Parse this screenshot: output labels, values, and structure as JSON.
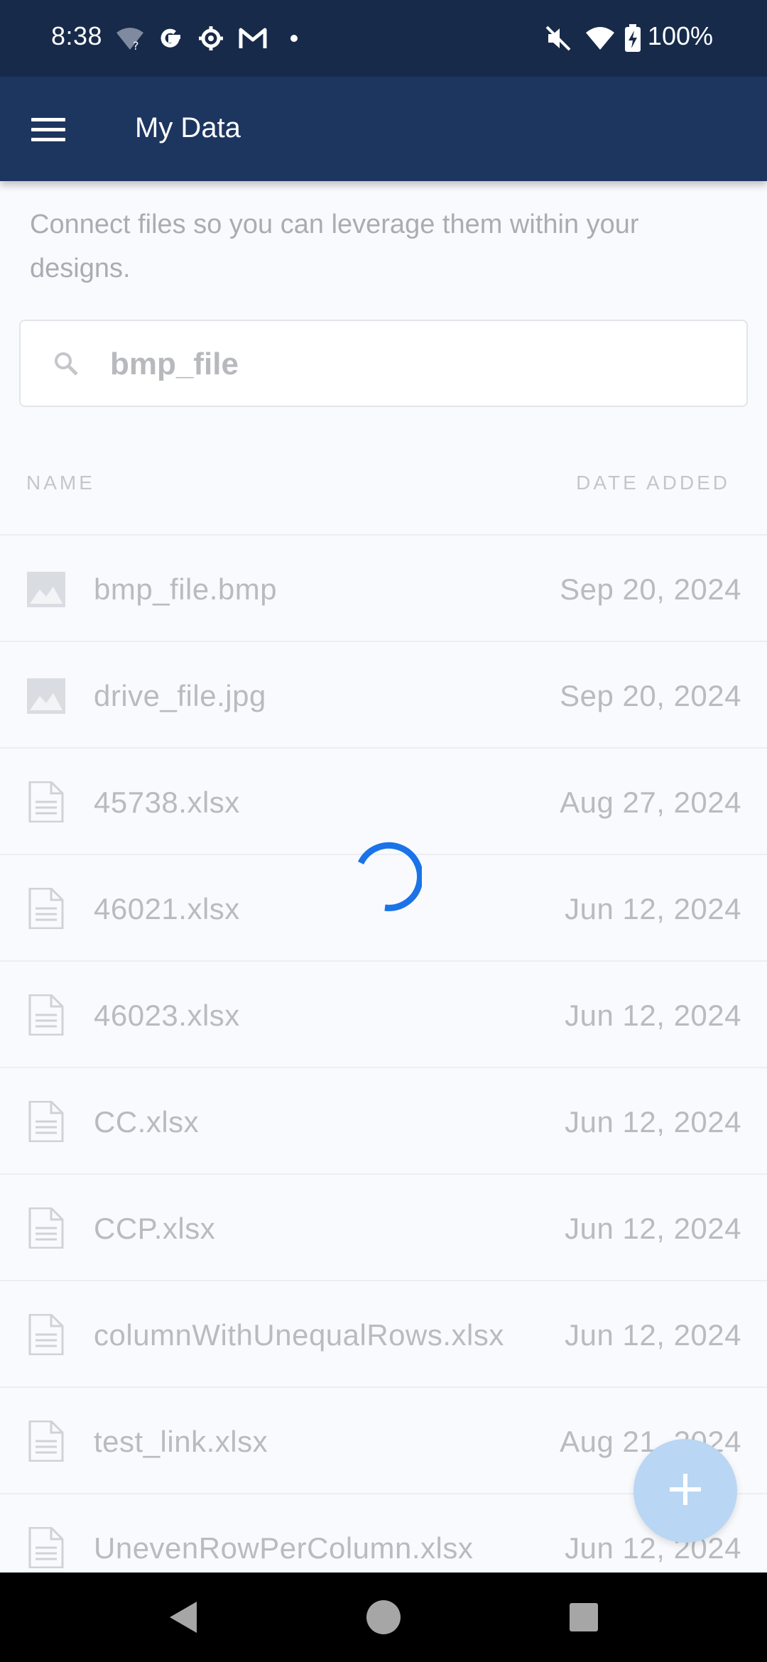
{
  "status_bar": {
    "time": "8:38",
    "icons": [
      "wifi-unknown-icon",
      "google-icon",
      "settings-icon",
      "gmail-icon",
      "dot-icon"
    ],
    "right_icons": [
      "mute-icon",
      "wifi-icon",
      "battery-charging-icon"
    ],
    "battery": "100%"
  },
  "app_bar": {
    "menu_icon": "hamburger-menu-icon",
    "title": "My Data"
  },
  "description": "Connect files so you can leverage them within your designs.",
  "search": {
    "icon": "search-icon",
    "value": "bmp_file"
  },
  "table": {
    "headers": {
      "name": "NAME",
      "date": "DATE ADDED"
    },
    "rows": [
      {
        "icon": "image-file-icon",
        "name": "bmp_file.bmp",
        "date": "Sep 20, 2024"
      },
      {
        "icon": "image-file-icon",
        "name": "drive_file.jpg",
        "date": "Sep 20, 2024"
      },
      {
        "icon": "document-file-icon",
        "name": "45738.xlsx",
        "date": "Aug 27, 2024"
      },
      {
        "icon": "document-file-icon",
        "name": "46021.xlsx",
        "date": "Jun 12, 2024"
      },
      {
        "icon": "document-file-icon",
        "name": "46023.xlsx",
        "date": "Jun 12, 2024"
      },
      {
        "icon": "document-file-icon",
        "name": "CC.xlsx",
        "date": "Jun 12, 2024"
      },
      {
        "icon": "document-file-icon",
        "name": "CCP.xlsx",
        "date": "Jun 12, 2024"
      },
      {
        "icon": "document-file-icon",
        "name": "columnWithUnequalRows.xlsx",
        "date": "Jun 12, 2024"
      },
      {
        "icon": "document-file-icon",
        "name": "test_link.xlsx",
        "date": "Aug 21, 2024"
      },
      {
        "icon": "document-file-icon",
        "name": "UnevenRowPerColumn.xlsx",
        "date": "Jun 12, 2024"
      }
    ]
  },
  "loading_indicator": "loading-spinner-icon",
  "fab": {
    "icon": "plus-icon"
  },
  "nav_bar": {
    "buttons": [
      "back-icon",
      "home-icon",
      "recents-icon"
    ]
  },
  "colors": {
    "status_bar": "#172a4a",
    "app_bar": "#1d3660",
    "spinner": "#1a73e8",
    "fab": "#b9d6f4"
  }
}
